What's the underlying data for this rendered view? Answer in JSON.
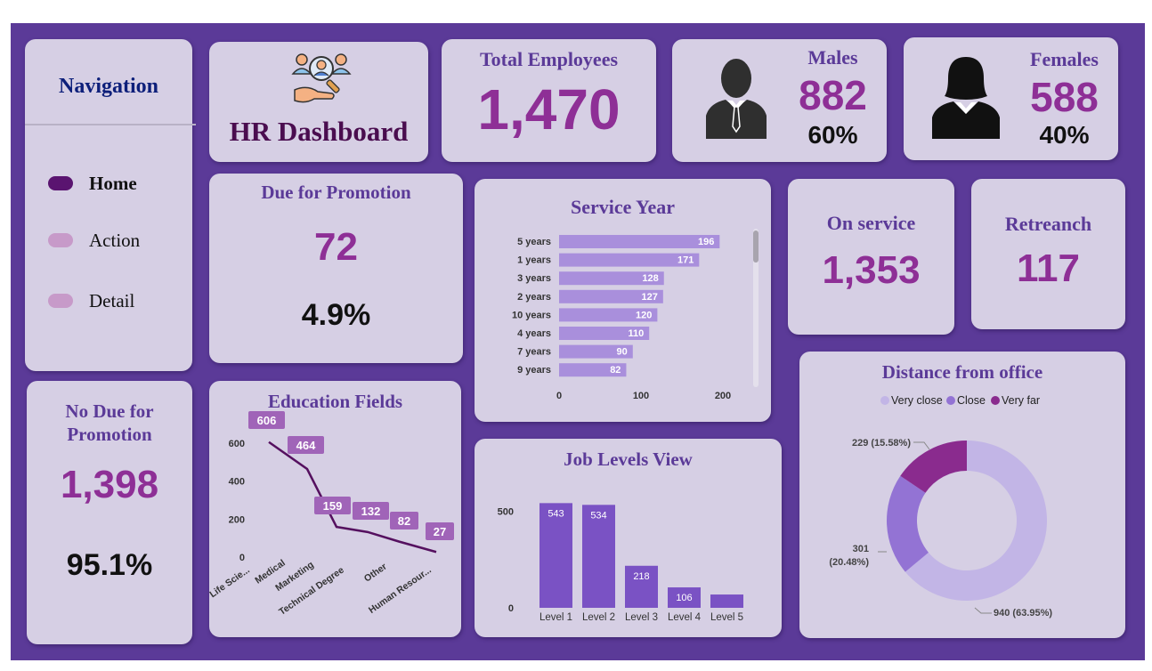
{
  "colors": {
    "board": "#5b3a98",
    "card": "#d6cfe4",
    "accent": "#8e2f96",
    "nav_active": "#5a1470",
    "nav_inactive": "#c79ac9",
    "bar_light": "#a98fdc",
    "bar_dark": "#7a52c4",
    "line": "#55105f",
    "donut_very_close": "#c2b5e6",
    "donut_close": "#9373d4",
    "donut_very_far": "#8a2b8e"
  },
  "nav": {
    "title": "Navigation",
    "items": [
      {
        "label": "Home",
        "active": true
      },
      {
        "label": "Action",
        "active": false
      },
      {
        "label": "Detail",
        "active": false
      }
    ]
  },
  "header": {
    "title": "HR Dashboard",
    "icon": "hr-team-search-icon"
  },
  "total": {
    "title": "Total Employees",
    "value": "1,470"
  },
  "males": {
    "title": "Males",
    "value": "882",
    "pct": "60%",
    "icon": "male-person-icon"
  },
  "females": {
    "title": "Females",
    "value": "588",
    "pct": "40%",
    "icon": "female-person-icon"
  },
  "promotion": {
    "title": "Due for Promotion",
    "value": "72",
    "pct": "4.9%"
  },
  "no_promotion": {
    "title_line1": "No Due for",
    "title_line2": "Promotion",
    "value": "1,398",
    "pct": "95.1%"
  },
  "on_service": {
    "title": "On service",
    "value": "1,353"
  },
  "retrench": {
    "title": "Retreanch",
    "value": "117"
  },
  "chart_data": [
    {
      "id": "service_year",
      "type": "bar",
      "orientation": "horizontal",
      "title": "Service Year",
      "categories": [
        "5 years",
        "1 years",
        "3 years",
        "2 years",
        "10 years",
        "4 years",
        "7 years",
        "9 years"
      ],
      "values": [
        196,
        171,
        128,
        127,
        120,
        110,
        90,
        82
      ],
      "xlim": [
        0,
        200
      ],
      "xticks": [
        "0",
        "100",
        "200"
      ],
      "xlabel": "",
      "ylabel": ""
    },
    {
      "id": "education_fields",
      "type": "line",
      "title": "Education Fields",
      "categories": [
        "Life Scie...",
        "Medical",
        "Marketing",
        "Technical Degree",
        "Other",
        "Human Resour..."
      ],
      "values": [
        606,
        464,
        159,
        132,
        82,
        27
      ],
      "ylim": [
        0,
        600
      ],
      "yticks": [
        "0",
        "200",
        "400",
        "600"
      ],
      "xlabel": "",
      "ylabel": ""
    },
    {
      "id": "job_levels",
      "type": "bar",
      "title": "Job Levels View",
      "categories": [
        "Level 1",
        "Level 2",
        "Level 3",
        "Level 4",
        "Level 5"
      ],
      "values": [
        543,
        534,
        218,
        106,
        69
      ],
      "labels": [
        "543",
        "534",
        "218",
        "106",
        ""
      ],
      "ylim": [
        0,
        600
      ],
      "yticks": [
        "0",
        "500"
      ],
      "xlabel": "",
      "ylabel": ""
    },
    {
      "id": "distance",
      "type": "pie",
      "donut": true,
      "title": "Distance from office",
      "legend": [
        "Very close",
        "Close",
        "Very far"
      ],
      "legend_position": "top",
      "slices": [
        {
          "name": "Very close",
          "value": 940,
          "label": "940 (63.95%)"
        },
        {
          "name": "Close",
          "value": 301,
          "label_line1": "301",
          "label_line2": "(20.48%)"
        },
        {
          "name": "Very far",
          "value": 229,
          "label": "229 (15.58%)"
        }
      ]
    }
  ]
}
